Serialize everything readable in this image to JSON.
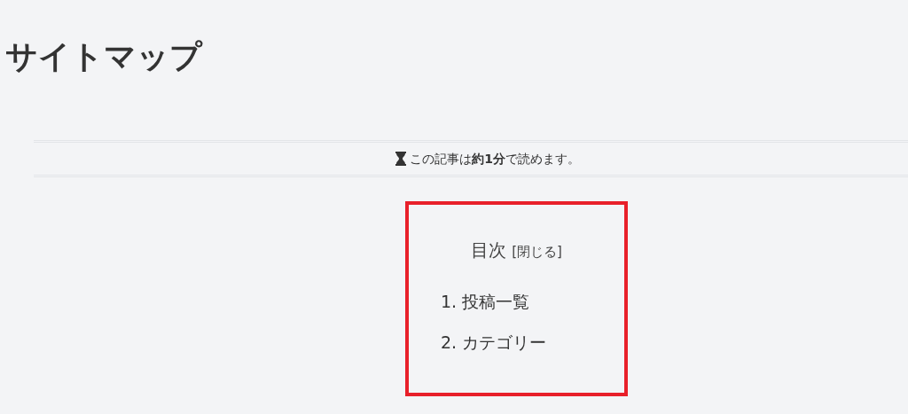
{
  "page_title": "サイトマップ",
  "reading_time": {
    "text": "この記事は**約1分**で読めます。"
  },
  "toc": {
    "title": "目次",
    "toggle": "[閉じる]",
    "highlighted": true,
    "items": [
      {
        "number": "1.",
        "label": "投稿一覧"
      },
      {
        "number": "2.",
        "label": "カテゴリー"
      }
    ]
  }
}
